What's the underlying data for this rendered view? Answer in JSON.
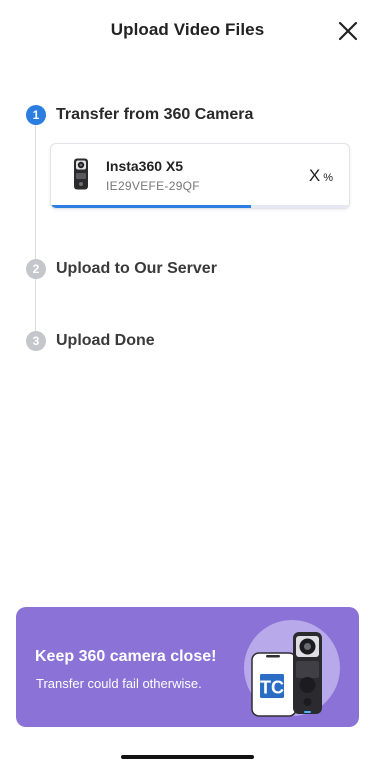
{
  "header": {
    "title": "Upload Video Files",
    "close_icon": "close-icon"
  },
  "steps": [
    {
      "number": "1",
      "label": "Transfer from 360 Camera",
      "state": "active"
    },
    {
      "number": "2",
      "label": "Upload to Our Server",
      "state": "inactive"
    },
    {
      "number": "3",
      "label": "Upload Done",
      "state": "inactive"
    }
  ],
  "device": {
    "name": "Insta360 X5",
    "serial": "IE29VEFE-29QF",
    "progress_value": "X",
    "progress_unit": "%",
    "progress_fill_fraction": 0.67,
    "icon": "camera-icon"
  },
  "banner": {
    "title": "Keep 360 camera close!",
    "subtitle": "Transfer could fail otherwise.",
    "illustration_badge": "TC",
    "illustration_icon": "phone-camera-illustration"
  },
  "colors": {
    "accent": "#2b7de0",
    "inactive_step": "#c5c5cc",
    "banner_bg": "#8a72d6",
    "banner_circle": "#b7a9ea",
    "progress_track": "#e6e8f2"
  }
}
